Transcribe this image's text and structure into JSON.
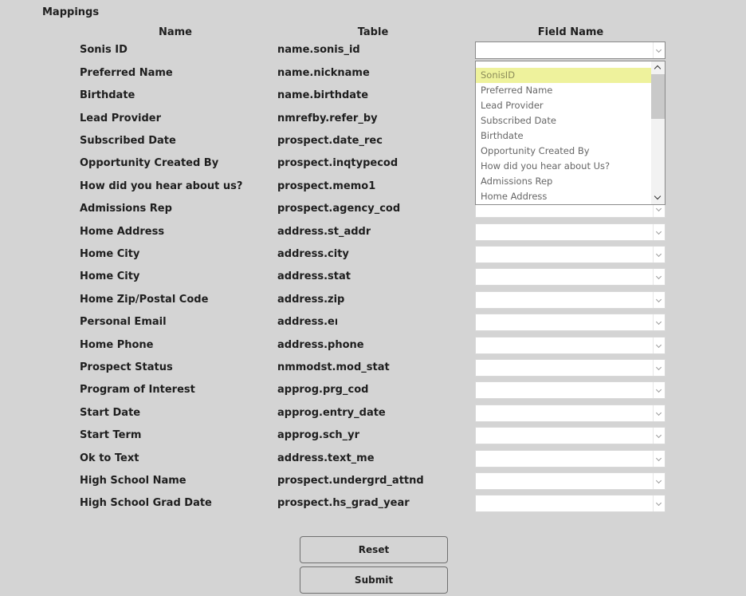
{
  "section_title": "Mappings",
  "headers": {
    "name": "Name",
    "table": "Table",
    "field_name": "Field Name"
  },
  "rows": [
    {
      "name": "Sonis ID",
      "table": "name.sonis_id"
    },
    {
      "name": "Preferred Name",
      "table": "name.nickname"
    },
    {
      "name": "Birthdate",
      "table": "name.birthdate"
    },
    {
      "name": "Lead Provider",
      "table": "nmrefby.refer_by"
    },
    {
      "name": "Subscribed Date",
      "table": "prospect.date_rec"
    },
    {
      "name": "Opportunity Created By",
      "table": "prospect.inqtypecod"
    },
    {
      "name": "How did you hear about us?",
      "table": "prospect.memo1"
    },
    {
      "name": "Admissions Rep",
      "table": "prospect.agency_cod"
    },
    {
      "name": "Home Address",
      "table": "address.st_addr"
    },
    {
      "name": "Home City",
      "table": "address.city"
    },
    {
      "name": "Home City",
      "table": "address.stat"
    },
    {
      "name": "Home Zip/Postal Code",
      "table": "address.zip"
    },
    {
      "name": "Personal Email",
      "table": "address.ema"
    },
    {
      "name": "Home Phone",
      "table": "address.phone"
    },
    {
      "name": "Prospect Status",
      "table": "nmmodst.mod_stat"
    },
    {
      "name": "Program of Interest",
      "table": "approg.prg_cod"
    },
    {
      "name": "Start Date",
      "table": "approg.entry_date"
    },
    {
      "name": "Start Term",
      "table": "approg.sch_yr"
    },
    {
      "name": "Ok to Text",
      "table": "address.text_me"
    },
    {
      "name": "High School Name",
      "table": "prospect.undergrd_attnd"
    },
    {
      "name": "High School Grad Date",
      "table": "prospect.hs_grad_year"
    }
  ],
  "dropdown": {
    "options": [
      "SonisID",
      "Preferred Name",
      "Lead Provider",
      "Subscribed Date",
      "Birthdate",
      "Opportunity Created By",
      "How did you hear about Us?",
      "Admissions Rep",
      "Home Address"
    ],
    "highlighted": "SonisID",
    "highlight_color": "#eef29c"
  },
  "buttons": {
    "reset": "Reset",
    "submit": "Submit"
  }
}
